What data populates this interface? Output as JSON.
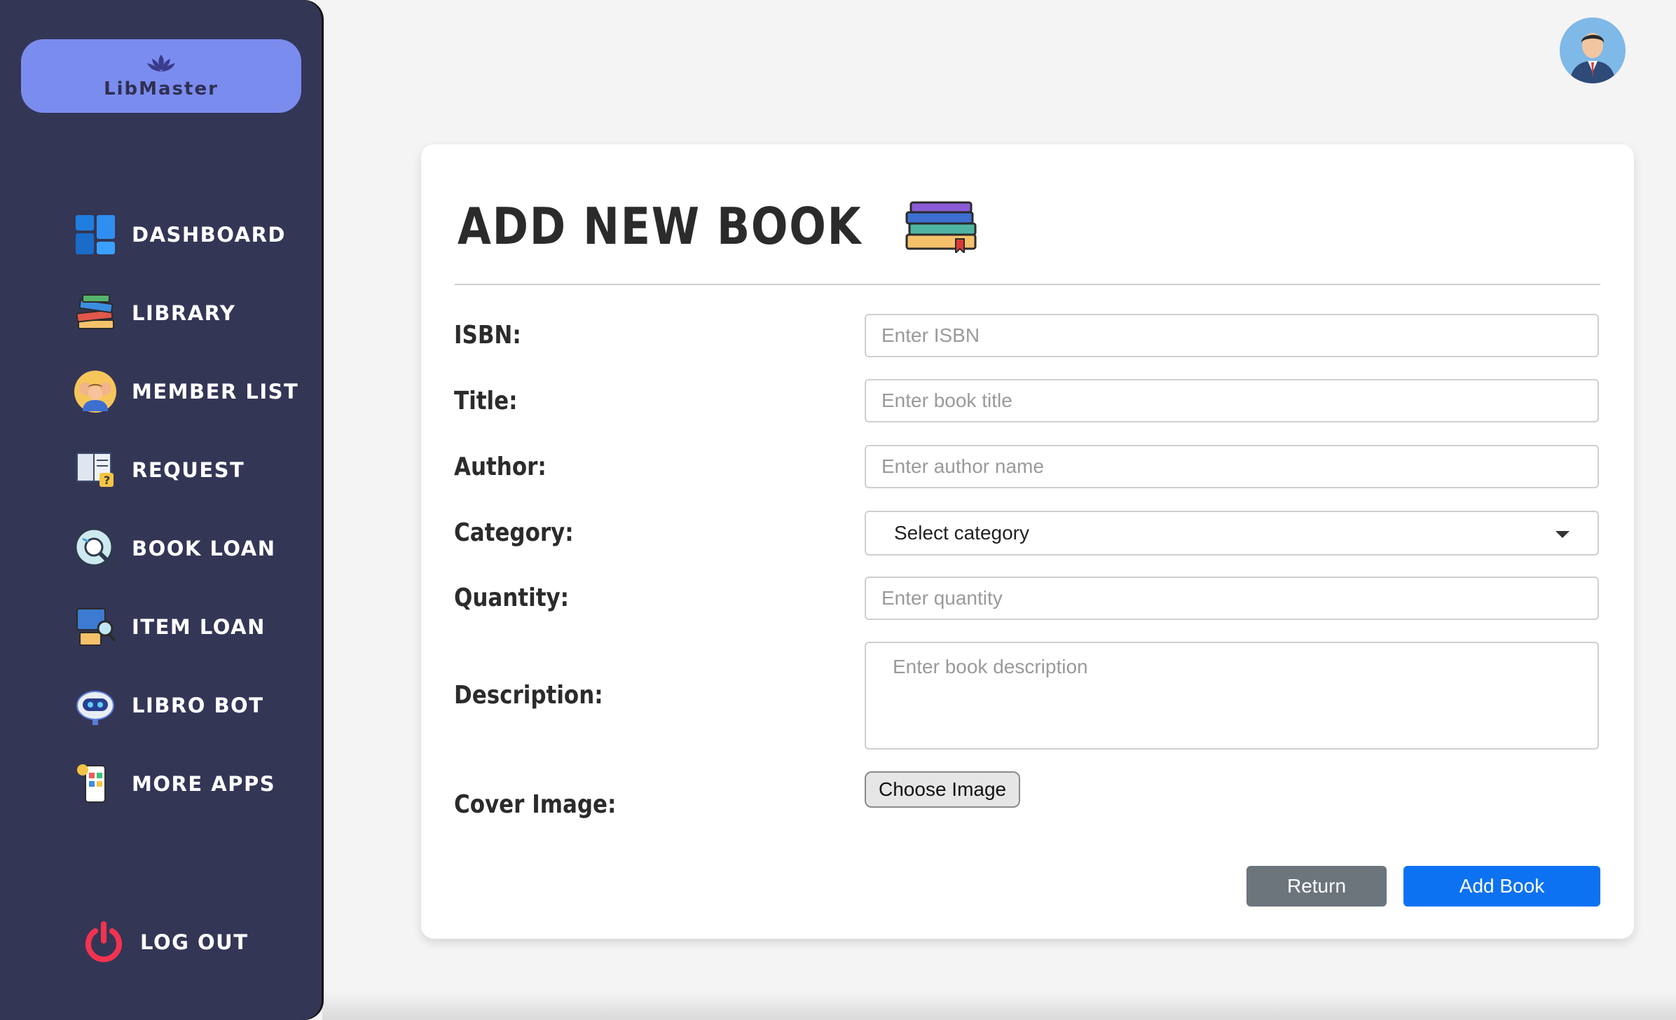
{
  "sidebar": {
    "brand": "LibMaster",
    "items": [
      {
        "label": "DASHBOARD",
        "icon": "dashboard-icon"
      },
      {
        "label": "LIBRARY",
        "icon": "books-icon"
      },
      {
        "label": "MEMBER LIST",
        "icon": "members-icon"
      },
      {
        "label": "REQUEST",
        "icon": "request-icon"
      },
      {
        "label": "BOOK LOAN",
        "icon": "book-loan-icon"
      },
      {
        "label": "ITEM LOAN",
        "icon": "item-loan-icon"
      },
      {
        "label": "LIBRO BOT",
        "icon": "robot-icon"
      },
      {
        "label": "MORE APPS",
        "icon": "apps-icon"
      }
    ],
    "logout": "LOG OUT"
  },
  "page": {
    "title": "ADD NEW BOOK"
  },
  "form": {
    "isbn": {
      "label": "ISBN:",
      "placeholder": "Enter ISBN"
    },
    "title": {
      "label": "Title:",
      "placeholder": "Enter book title"
    },
    "author": {
      "label": "Author:",
      "placeholder": "Enter author name"
    },
    "category": {
      "label": "Category:",
      "selected": "Select category"
    },
    "quantity": {
      "label": "Quantity:",
      "placeholder": "Enter quantity"
    },
    "description": {
      "label": "Description:",
      "placeholder": "Enter book description"
    },
    "cover": {
      "label": "Cover Image:",
      "button": "Choose Image"
    }
  },
  "actions": {
    "return_label": "Return",
    "add_label": "Add Book"
  },
  "colors": {
    "sidebar": "#343656",
    "brand": "#7b8cef",
    "primary": "#0d72f2",
    "secondary": "#6c747c"
  }
}
